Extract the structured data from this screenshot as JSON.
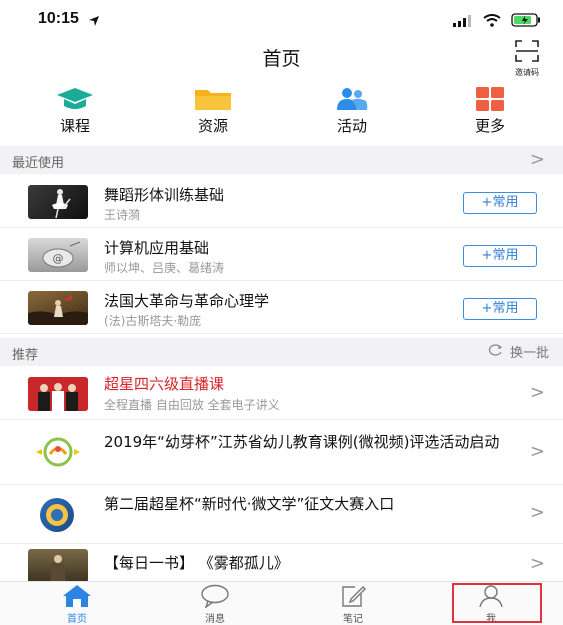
{
  "status": {
    "time": "10:15"
  },
  "header": {
    "title": "首页",
    "invite_label": "邀请码"
  },
  "quick_actions": [
    {
      "label": "课程",
      "icon": "graduation-cap-icon",
      "color": "#1cab97"
    },
    {
      "label": "资源",
      "icon": "folder-icon",
      "color": "#f5b21a"
    },
    {
      "label": "活动",
      "icon": "people-icon",
      "color": "#2d8de6"
    },
    {
      "label": "更多",
      "icon": "grid-icon",
      "color": "#ef5f43"
    }
  ],
  "recent": {
    "title": "最近使用",
    "items": [
      {
        "title": "舞蹈形体训练基础",
        "subtitle": "王诗漪",
        "button": "+常用"
      },
      {
        "title": "计算机应用基础",
        "subtitle": "师以坤、吕庚、葛绪涛",
        "button": "+常用"
      },
      {
        "title": "法国大革命与革命心理学",
        "subtitle": "(法)古斯塔夫·勒庞",
        "button": "+常用"
      }
    ]
  },
  "recommend": {
    "title": "推荐",
    "refresh_label": "换一批",
    "items": [
      {
        "title": "超星四六级直播课",
        "tags": "全程直播    自由回放    全套电子讲义"
      },
      {
        "title": "2019年“幼芽杯”江苏省幼儿教育课例(微视频)评选活动启动"
      },
      {
        "title": "第二届超星杯“新时代·微文学”征文大赛入口"
      },
      {
        "title": "【每日一书】 《雾都孤儿》"
      }
    ]
  },
  "tabbar": [
    {
      "label": "首页",
      "icon": "home-icon",
      "active": true
    },
    {
      "label": "消息",
      "icon": "chat-bubble-icon",
      "active": false
    },
    {
      "label": "笔记",
      "icon": "note-edit-icon",
      "active": false
    },
    {
      "label": "我",
      "icon": "person-icon",
      "active": false
    }
  ],
  "colors": {
    "accent": "#2c85e3",
    "highlight": "#e0323a",
    "promo_red": "#d8242b"
  }
}
